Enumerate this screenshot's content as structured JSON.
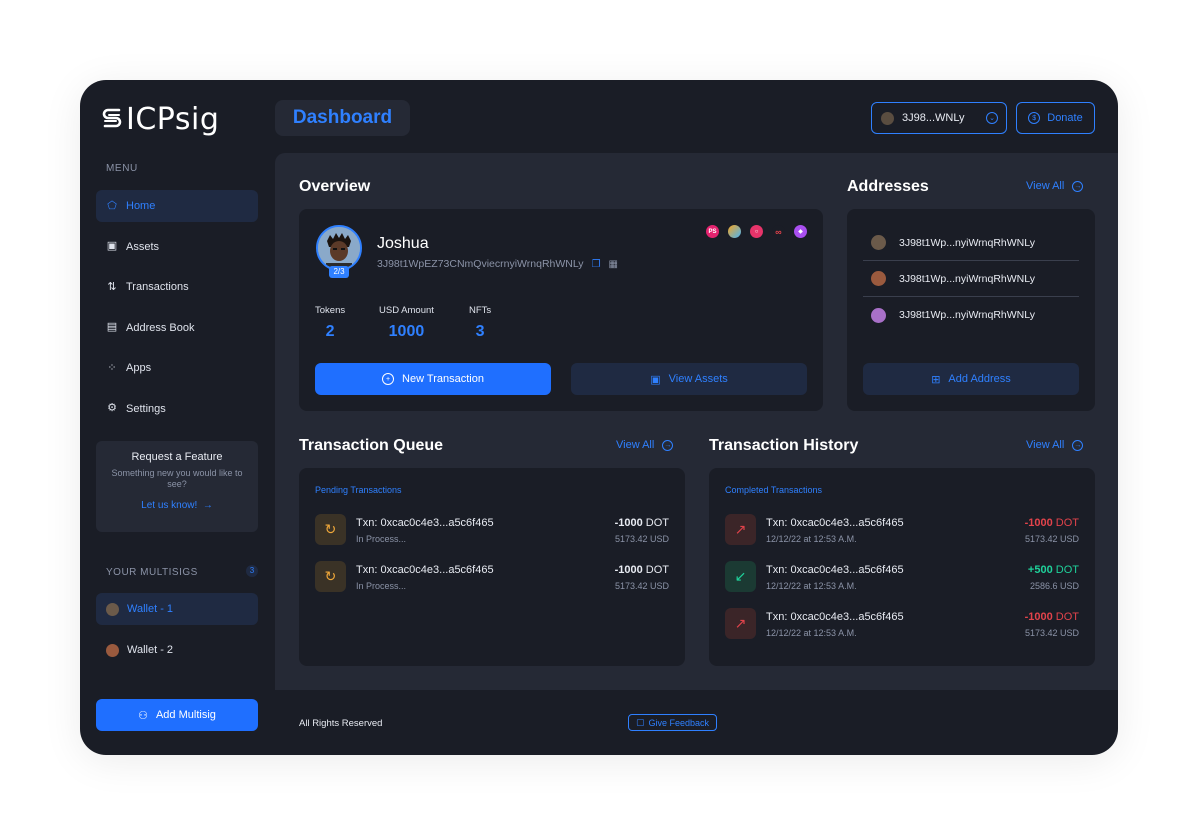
{
  "app": {
    "name": "ICPsig"
  },
  "sidebar": {
    "menu_label": "MENU",
    "items": [
      {
        "label": "Home",
        "icon": "home-icon"
      },
      {
        "label": "Assets",
        "icon": "wallet-icon"
      },
      {
        "label": "Transactions",
        "icon": "transfer-icon"
      },
      {
        "label": "Address Book",
        "icon": "book-icon"
      },
      {
        "label": "Apps",
        "icon": "grid-icon"
      },
      {
        "label": "Settings",
        "icon": "gear-icon"
      }
    ],
    "feature": {
      "title": "Request a Feature",
      "description": "Something new you would like to see?",
      "link": "Let us know!"
    },
    "multisigs_label": "YOUR MULTISIGS",
    "multisigs_count": "3",
    "wallets": [
      "Wallet - 1",
      "Wallet - 2"
    ],
    "add_multisig": "Add Multisig"
  },
  "header": {
    "title": "Dashboard",
    "wallet_address": "3J98...WNLy",
    "donate": "Donate"
  },
  "overview": {
    "title": "Overview",
    "name": "Joshua",
    "badge": "2/3",
    "address": "3J98t1WpEZ73CNmQviecrnyiWrnqRhWNLy",
    "tokens_icons": [
      "PS",
      "rainbow",
      "OC",
      "infinity",
      "cube"
    ],
    "stats": [
      {
        "label": "Tokens",
        "value": "2"
      },
      {
        "label": "USD Amount",
        "value": "1000"
      },
      {
        "label": "NFTs",
        "value": "3"
      }
    ],
    "new_transaction": "New Transaction",
    "view_assets": "View Assets"
  },
  "addresses": {
    "title": "Addresses",
    "view_all": "View All",
    "items": [
      "3J98t1Wp...nyiWrnqRhWNLy",
      "3J98t1Wp...nyiWrnqRhWNLy",
      "3J98t1Wp...nyiWrnqRhWNLy"
    ],
    "add_address": "Add Address"
  },
  "queue": {
    "title": "Transaction Queue",
    "view_all": "View All",
    "subtitle": "Pending Transactions",
    "items": [
      {
        "txn": "Txn: 0xcac0c4e3...a5c6f465",
        "status": "In Process...",
        "amount": "-1000",
        "unit": "DOT",
        "usd": "5173.42 USD"
      },
      {
        "txn": "Txn: 0xcac0c4e3...a5c6f465",
        "status": "In Process...",
        "amount": "-1000",
        "unit": "DOT",
        "usd": "5173.42 USD"
      }
    ]
  },
  "history": {
    "title": "Transaction History",
    "view_all": "View All",
    "subtitle": "Completed Transactions",
    "items": [
      {
        "txn": "Txn: 0xcac0c4e3...a5c6f465",
        "date": "12/12/22 at 12:53 A.M.",
        "amount": "-1000",
        "unit": "DOT",
        "usd": "5173.42 USD",
        "direction": "out"
      },
      {
        "txn": "Txn: 0xcac0c4e3...a5c6f465",
        "date": "12/12/22 at 12:53 A.M.",
        "amount": "+500",
        "unit": "DOT",
        "usd": "2586.6 USD",
        "direction": "in"
      },
      {
        "txn": "Txn: 0xcac0c4e3...a5c6f465",
        "date": "12/12/22 at 12:53 A.M.",
        "amount": "-1000",
        "unit": "DOT",
        "usd": "5173.42 USD",
        "direction": "out"
      }
    ]
  },
  "footer": {
    "rights": "All Rights Reserved",
    "feedback": "Give Feedback"
  },
  "colors": {
    "accent": "#2f80ff",
    "background": "#1a1d26",
    "panel": "#252935",
    "negative": "#e2434b",
    "positive": "#1fd19a",
    "pending": "#f0a83a"
  }
}
